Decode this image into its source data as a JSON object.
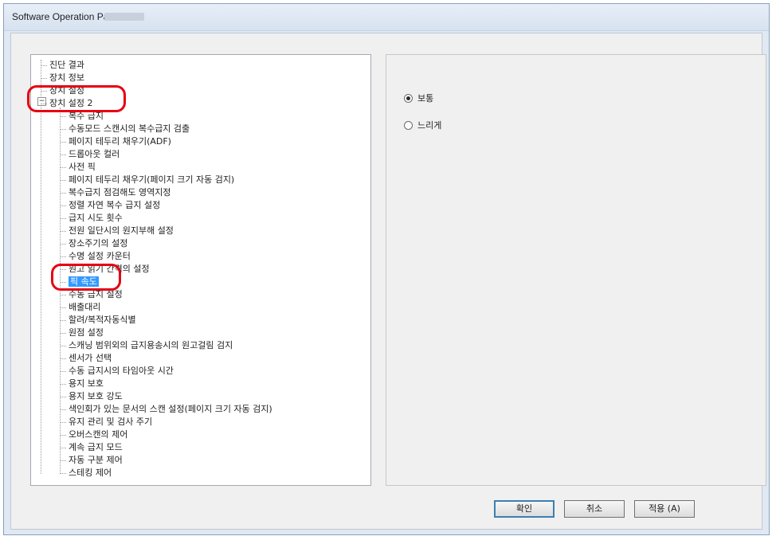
{
  "window": {
    "title": "Software Operation Panel fi-"
  },
  "tree": {
    "items": [
      {
        "label": "진단 결과",
        "indent": 0
      },
      {
        "label": "장치 정보",
        "indent": 0
      },
      {
        "label": "장치 설정",
        "indent": 0
      },
      {
        "label": "장치 설정 2",
        "indent": 0,
        "expanded": true
      },
      {
        "label": "복수 급지",
        "indent": 1
      },
      {
        "label": "수동모드 스캔시의 복수급지 검출",
        "indent": 1
      },
      {
        "label": "페이지 테두리 채우기(ADF)",
        "indent": 1
      },
      {
        "label": "드롭아웃 컬러",
        "indent": 1
      },
      {
        "label": "사전 픽",
        "indent": 1
      },
      {
        "label": "페이지 테두리 채우기(페이지 크기 자동 검지)",
        "indent": 1
      },
      {
        "label": "복수급지 점검해도 영역지정",
        "indent": 1
      },
      {
        "label": "정렬 자연 복수 급지 설정",
        "indent": 1
      },
      {
        "label": "급지 시도 횟수",
        "indent": 1
      },
      {
        "label": "전원 일단시의 원지부해 설정",
        "indent": 1
      },
      {
        "label": "장소주기의 설정",
        "indent": 1
      },
      {
        "label": "수명 설정 카운터",
        "indent": 1
      },
      {
        "label": "원고 읽기 간격의 설정",
        "indent": 1
      },
      {
        "label": "픽 속도",
        "indent": 1,
        "selected": true
      },
      {
        "label": "수동 급지 설정",
        "indent": 1
      },
      {
        "label": "배출대리",
        "indent": 1
      },
      {
        "label": "할려/복적자동식별",
        "indent": 1
      },
      {
        "label": "원점 설정",
        "indent": 1
      },
      {
        "label": "스캐닝 범위외의 급지용송시의 원고걸림 검지",
        "indent": 1
      },
      {
        "label": "센서가 선택",
        "indent": 1
      },
      {
        "label": "수동 급지시의 타임아웃 시간",
        "indent": 1
      },
      {
        "label": "용지 보호",
        "indent": 1
      },
      {
        "label": "용지 보호 강도",
        "indent": 1
      },
      {
        "label": "색인회가 있는 문서의 스캔 설정(페이지 크기 자동 검지)",
        "indent": 1
      },
      {
        "label": "유지 관리 및 검사 주기",
        "indent": 1
      },
      {
        "label": "오버스캔의 제어",
        "indent": 1
      },
      {
        "label": "계속 급지 모드",
        "indent": 1
      },
      {
        "label": "자동 구분 제어",
        "indent": 1
      },
      {
        "label": "스테킹 제어",
        "indent": 1
      }
    ]
  },
  "options": {
    "normal": {
      "label": "보통",
      "selected": true
    },
    "slow": {
      "label": "느리게",
      "selected": false
    }
  },
  "buttons": {
    "ok": "확인",
    "cancel": "취소",
    "apply": "적용 (A)"
  },
  "annotations": {
    "highlight_color": "#e60012"
  }
}
